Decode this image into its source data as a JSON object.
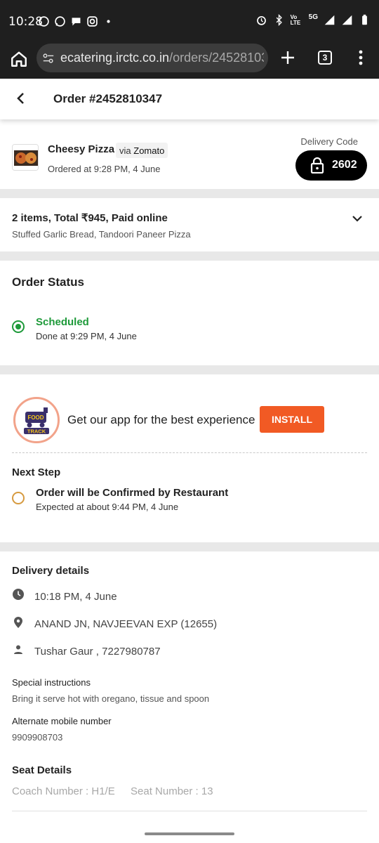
{
  "status_bar": {
    "time": "10:28",
    "network": "5G",
    "volte": "Vo LTE"
  },
  "browser": {
    "url_host": "ecatering.irctc.co.in",
    "url_path": "/orders/24528103",
    "tab_count": "3"
  },
  "header": {
    "title": "Order #2452810347"
  },
  "order": {
    "restaurant": "Cheesy Pizza",
    "via_prefix": "via",
    "via_name": "Zomato",
    "ordered_at": "Ordered at 9:28 PM, 4 June",
    "delivery_code_label": "Delivery Code",
    "delivery_code": "2602"
  },
  "items": {
    "summary": "2 items, Total ₹945, Paid online",
    "list": "Stuffed Garlic Bread, Tandoori Paneer Pizza"
  },
  "order_status": {
    "title": "Order Status",
    "current_label": "Scheduled",
    "current_time": "Done at 9:29 PM, 4 June"
  },
  "app_promo": {
    "logo_text_1": "FOOD",
    "logo_text_2": "TRACK",
    "text": "Get our app for the best experience",
    "button": "INSTALL"
  },
  "next_step": {
    "title": "Next Step",
    "label": "Order will be Confirmed by Restaurant",
    "time": "Expected at about 9:44 PM, 4 June"
  },
  "delivery": {
    "title": "Delivery details",
    "time": "10:18 PM, 4 June",
    "station": "ANAND JN, NAVJEEVAN EXP (12655)",
    "contact": "Tushar Gaur , 7227980787",
    "special_label": "Special instructions",
    "special_value": "Bring it serve hot with oregano, tissue and spoon",
    "alt_label": "Alternate mobile number",
    "alt_value": "9909908703"
  },
  "seat": {
    "title": "Seat Details",
    "coach": "Coach Number : H1/E",
    "seat": "Seat Number : 13"
  },
  "colors": {
    "green": "#1e9a3a",
    "orange": "#f15a24",
    "pending": "#d69a3f",
    "chrome_bg": "#1f1f1f"
  }
}
